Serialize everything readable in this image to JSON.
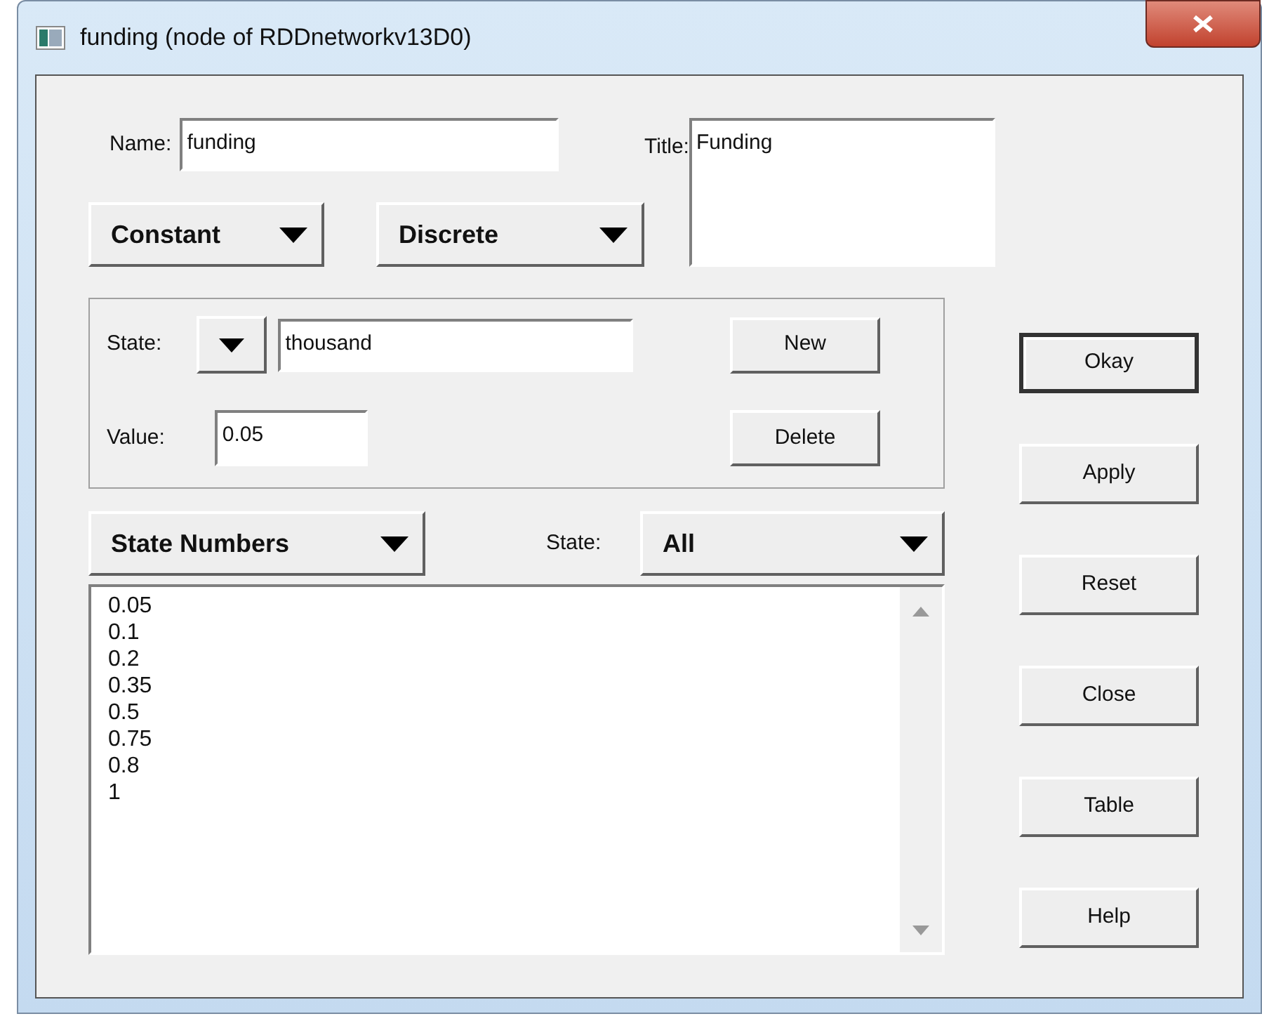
{
  "window": {
    "title": "funding (node of RDDnetworkv13D0)"
  },
  "name_field": {
    "label": "Name:",
    "value": "funding"
  },
  "title_field": {
    "label": "Title:",
    "value": "Funding"
  },
  "dropdowns": [
    {
      "value": "Constant"
    },
    {
      "value": "Discrete"
    }
  ],
  "state_group": {
    "state_label": "State:",
    "state_value": "thousand",
    "value_label": "Value:",
    "value": "0.05",
    "buttons": [
      "New",
      "Delete"
    ]
  },
  "list_view": {
    "mode": "State Numbers",
    "filter_label": "State:",
    "filter": "All",
    "items": [
      "0.05",
      "0.1",
      "0.2",
      "0.35",
      "0.5",
      "0.75",
      "0.8",
      "1"
    ]
  },
  "buttons": [
    {
      "label": "Okay",
      "default": true
    },
    {
      "label": "Apply",
      "default": false
    },
    {
      "label": "Reset",
      "default": false
    },
    {
      "label": "Close",
      "default": false
    },
    {
      "label": "Table",
      "default": false
    },
    {
      "label": "Help",
      "default": false
    }
  ]
}
